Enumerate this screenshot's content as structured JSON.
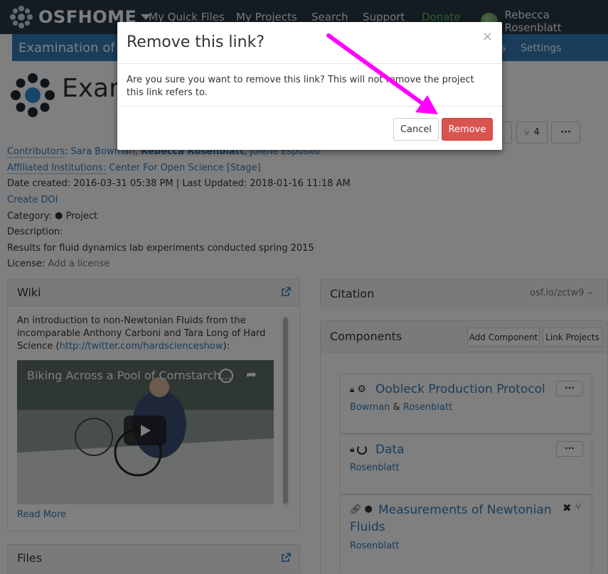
{
  "nav": {
    "brand": "OSFHOME",
    "items": [
      "My Quick Files",
      "My Projects",
      "Search",
      "Support",
      "Donate"
    ],
    "user": "Rebecca Rosenblatt"
  },
  "project_bar": {
    "title": "Examination of N",
    "links": [
      "s",
      "Settings"
    ]
  },
  "header": {
    "title": "Exam",
    "forks_count": "4",
    "more_label": "···"
  },
  "meta": {
    "contributors_label": "Contributors",
    "contributors": [
      "Sara Bowman",
      "Rebecca Rosenblatt",
      "Jolene Esposito"
    ],
    "institutions_label": "Affiliated Institutions:",
    "institution": "Center For Open Science [Stage]",
    "dates": "Date created: 2016-03-31 05:38 PM | Last Updated: 2018-01-16 11:18 AM",
    "create_doi": "Create DOI",
    "category_label": "Category:",
    "category": "Project",
    "description_label": "Description:",
    "description": "Results for fluid dynamics lab experiments conducted spring 2015",
    "license_label": "License:",
    "license_action": "Add a license"
  },
  "wiki": {
    "title": "Wiki",
    "text_before": "An introduction to non-Newtonian Fluids from the incomparable Anthony Carboni and Tara Long of Hard Science (",
    "link": "http://twitter.com/hardscienceshow",
    "text_after": "):",
    "video_title": "Biking Across a Pool of Cornstarch...",
    "read_more": "Read More"
  },
  "files": {
    "title": "Files"
  },
  "citation": {
    "title": "Citation",
    "value": "osf.io/zctw9"
  },
  "components": {
    "title": "Components",
    "add_button": "Add Component",
    "link_button": "Link Projects",
    "nodes": [
      {
        "title": "Oobleck Production Protocol",
        "contrib_a": "Bowman",
        "sep": " & ",
        "contrib_b": "Rosenblatt"
      },
      {
        "title": "Data",
        "contrib_a": "Rosenblatt"
      },
      {
        "title": "Measurements of Newtonian",
        "title2": "Fluids",
        "contrib_a": "Rosenblatt"
      }
    ]
  },
  "modal": {
    "title": "Remove this link?",
    "close": "×",
    "body": "Are you sure you want to remove this link? This will not remove the project this link refers to.",
    "cancel": "Cancel",
    "remove": "Remove"
  },
  "colors": {
    "nav_bg": "#263947",
    "project_bar": "#337ab7",
    "remove_button": "#d9534f",
    "arrow": "#ff00ff"
  }
}
